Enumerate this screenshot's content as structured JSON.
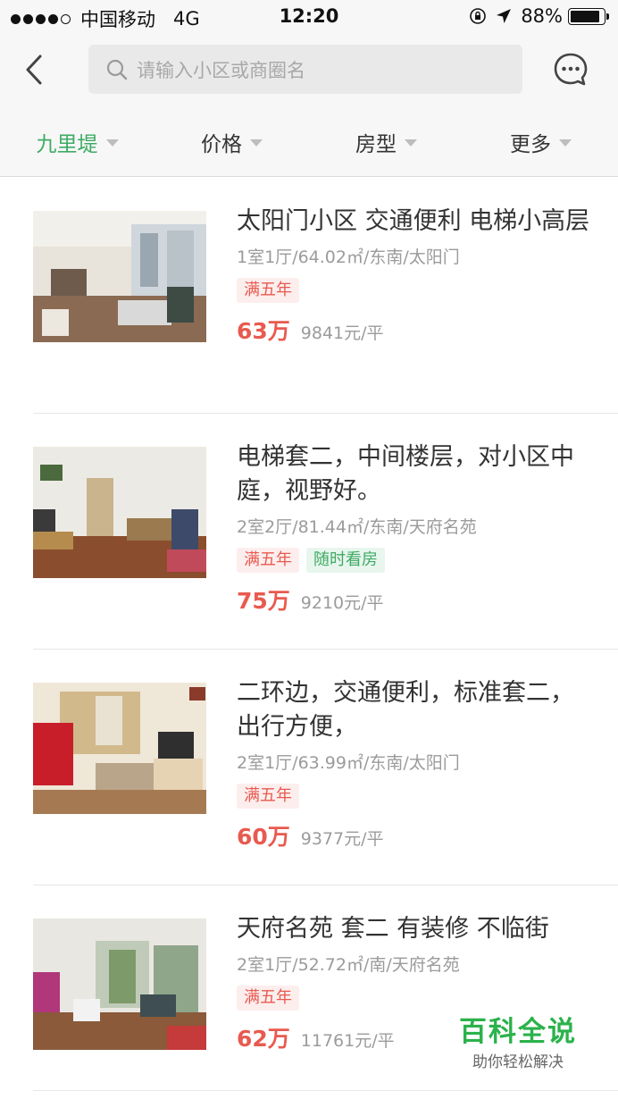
{
  "status_bar": {
    "carrier": "中国移动",
    "network": "4G",
    "time": "12:20",
    "battery": "88%"
  },
  "navbar": {
    "back_icon": "chevron-left-icon",
    "search_placeholder": "请输入小区或商圈名",
    "message_icon": "chat-bubble-icon"
  },
  "filters": [
    {
      "label": "九里堤",
      "active": true
    },
    {
      "label": "价格",
      "active": false
    },
    {
      "label": "房型",
      "active": false
    },
    {
      "label": "更多",
      "active": false
    }
  ],
  "colors": {
    "accent_green": "#3fab64",
    "price_red": "#e85a4f"
  },
  "listings": [
    {
      "title": "太阳门小区 交通便利 电梯小高层",
      "meta": "1室1厅/64.02㎡/东南/太阳门",
      "tags": [
        {
          "text": "满五年",
          "style": "red"
        }
      ],
      "price": "63万",
      "unit_price": "9841元/平"
    },
    {
      "title": "电梯套二，中间楼层，对小区中庭，视野好。",
      "meta": "2室2厅/81.44㎡/东南/天府名苑",
      "tags": [
        {
          "text": "满五年",
          "style": "red"
        },
        {
          "text": "随时看房",
          "style": "green"
        }
      ],
      "price": "75万",
      "unit_price": "9210元/平"
    },
    {
      "title": "二环边，交通便利，标准套二，出行方便，",
      "meta": "2室1厅/63.99㎡/东南/太阳门",
      "tags": [
        {
          "text": "满五年",
          "style": "red"
        }
      ],
      "price": "60万",
      "unit_price": "9377元/平"
    },
    {
      "title": "天府名苑 套二 有装修 不临街",
      "meta": "2室1厅/52.72㎡/南/天府名苑",
      "tags": [
        {
          "text": "满五年",
          "style": "red"
        }
      ],
      "price": "62万",
      "unit_price": "11761元/平"
    }
  ],
  "watermark": {
    "title": "百科全说",
    "subtitle": "助你轻松解决"
  }
}
